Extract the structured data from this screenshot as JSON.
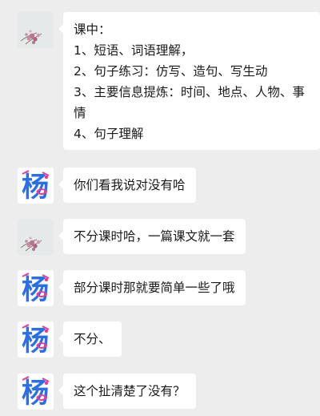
{
  "messages": [
    {
      "sender": "photo",
      "lines": [
        "课中：",
        "1、短语、词语理解，",
        "2、句子练习：仿写、造句、写生动",
        "3、主要信息提炼：时间、地点、人物、事",
        "情",
        "4、句子理解"
      ]
    },
    {
      "sender": "yang",
      "text": "你们看我说对没有哈"
    },
    {
      "sender": "photo",
      "text": "不分课时哈，一篇课文就一套"
    },
    {
      "sender": "yang",
      "text": "部分课时那就要简单一些了哦"
    },
    {
      "sender": "yang",
      "text": "不分、"
    },
    {
      "sender": "yang",
      "text": "这个扯清楚了没有？"
    }
  ],
  "avatar_yang_glyph": "杨",
  "colors": {
    "background": "#ededed",
    "bubble": "#ffffff",
    "text": "#1a1a1a",
    "yang_blue": "#2e6fe0",
    "yang_pink": "#e0409a"
  },
  "icons": {
    "photo_avatar": "flower-photo",
    "yang_avatar": "calligraphy-yang"
  }
}
